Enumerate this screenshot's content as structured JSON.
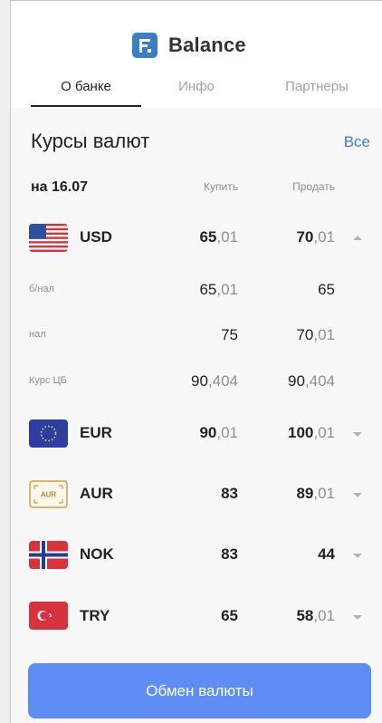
{
  "app": {
    "title": "Balance",
    "logo_icon": "balance-logo-icon",
    "accent": "#3f7ce6",
    "button_color": "#5e8df5"
  },
  "tabs": [
    {
      "label": "О банке",
      "active": true
    },
    {
      "label": "Инфо",
      "active": false
    },
    {
      "label": "Партнеры",
      "active": false
    }
  ],
  "rates": {
    "title": "Курсы валют",
    "all_label": "Все",
    "date_label": "на 16.07",
    "col_buy": "Купить",
    "col_sell": "Продать",
    "currencies": [
      {
        "code": "USD",
        "flag": "usa-flag-icon",
        "buy_int": "65",
        "buy_frac": ",01",
        "sell_int": "70",
        "sell_frac": ",01",
        "expanded": true,
        "details": [
          {
            "label": "б/нал",
            "buy_int": "65",
            "buy_frac": ",01",
            "sell_int": "65",
            "sell_frac": ""
          },
          {
            "label": "нал",
            "buy_int": "75",
            "buy_frac": "",
            "sell_int": "70",
            "sell_frac": ",01"
          },
          {
            "label": "Курс ЦБ",
            "buy_int": "90",
            "buy_frac": ",404",
            "sell_int": "90",
            "sell_frac": ",404"
          }
        ]
      },
      {
        "code": "EUR",
        "flag": "eu-flag-icon",
        "buy_int": "90",
        "buy_frac": ",01",
        "sell_int": "100",
        "sell_frac": ",01",
        "expanded": false
      },
      {
        "code": "AUR",
        "flag": "aur-badge-icon",
        "flag_text": "AUR",
        "buy_int": "83",
        "buy_frac": "",
        "sell_int": "89",
        "sell_frac": ",01",
        "expanded": false
      },
      {
        "code": "NOK",
        "flag": "norway-flag-icon",
        "buy_int": "83",
        "buy_frac": "",
        "sell_int": "44",
        "sell_frac": "",
        "expanded": false
      },
      {
        "code": "TRY",
        "flag": "turkey-flag-icon",
        "buy_int": "65",
        "buy_frac": "",
        "sell_int": "58",
        "sell_frac": ",01",
        "expanded": false
      }
    ]
  },
  "exchange_button": {
    "label": "Обмен валюты"
  }
}
